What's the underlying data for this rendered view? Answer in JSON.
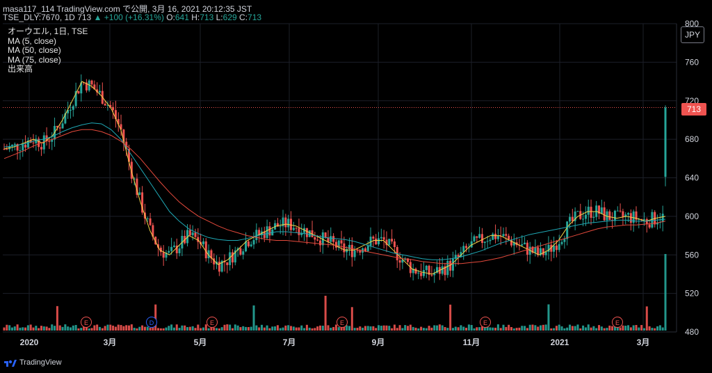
{
  "header": {
    "publish_line": "masa117_114 TradingView.com で公開, 3月 16, 2021 20:12:35 JST",
    "symbol": "TSE_DLY:7670, 1D",
    "last": "713",
    "change": "+100 (+16.31%)",
    "open_label": "O:",
    "open": "641",
    "high_label": "H:",
    "high": "713",
    "low_label": "L:",
    "low": "629",
    "close_label": "C:",
    "close": "713"
  },
  "legend": {
    "title": "オーウエル, 1日, TSE",
    "ma5": "MA (5, close)",
    "ma50": "MA (50, close)",
    "ma75": "MA (75, close)",
    "volume": "出来高"
  },
  "currency": "JPY",
  "price_badge": "713",
  "brand": "TradingView",
  "colors": {
    "up": "#26a69a",
    "down": "#ef5350",
    "ma5": "#f5d547",
    "ma50": "#1fa8b5",
    "ma75": "#e64a3c",
    "price_line": "#ef5350"
  },
  "events": [
    "E",
    "E",
    "D",
    "E",
    "E",
    "E",
    "E"
  ],
  "chart_data": {
    "type": "candlestick",
    "y_ticks": [
      480,
      520,
      560,
      600,
      640,
      680,
      720,
      760,
      800
    ],
    "ylim": [
      480,
      800
    ],
    "x_labels": [
      "2020",
      "3月",
      "5月",
      "7月",
      "9月",
      "11月",
      "2021",
      "3月"
    ],
    "grid": true,
    "series": [
      {
        "name": "MA (5, close)",
        "values": [
          670,
          672,
          676,
          680,
          676,
          684,
          700,
          720,
          740,
          735,
          725,
          712,
          690,
          650,
          615,
          585,
          565,
          560,
          570,
          580,
          575,
          560,
          550,
          555,
          565,
          575,
          580,
          585,
          590,
          592,
          590,
          585,
          580,
          575,
          570,
          565,
          565,
          570,
          575,
          575,
          565,
          555,
          545,
          542,
          540,
          545,
          550,
          560,
          570,
          575,
          580,
          580,
          575,
          570,
          565,
          560,
          565,
          575,
          590,
          600,
          605,
          605,
          600,
          598,
          600,
          598,
          595,
          598,
          600
        ]
      },
      {
        "name": "MA (50, close)",
        "values": [
          672,
          673,
          675,
          678,
          680,
          683,
          688,
          692,
          695,
          697,
          696,
          690,
          680,
          665,
          650,
          635,
          620,
          605,
          595,
          587,
          582,
          578,
          576,
          575,
          575,
          577,
          580,
          582,
          584,
          584,
          583,
          582,
          580,
          578,
          577,
          576,
          574,
          571,
          568,
          565,
          562,
          560,
          558,
          556,
          555,
          555,
          556,
          558,
          561,
          564,
          568,
          572,
          575,
          578,
          581,
          583,
          585,
          587,
          589,
          591,
          593,
          594,
          595,
          596,
          596,
          595,
          595,
          596,
          597
        ]
      },
      {
        "name": "MA (75, close)",
        "values": [
          660,
          664,
          668,
          673,
          677,
          680,
          684,
          688,
          690,
          690,
          688,
          684,
          678,
          670,
          660,
          648,
          636,
          625,
          615,
          607,
          600,
          595,
          590,
          586,
          583,
          580,
          578,
          576,
          575,
          575,
          574,
          573,
          572,
          571,
          570,
          568,
          566,
          564,
          562,
          560,
          558,
          556,
          555,
          553,
          552,
          551,
          551,
          551,
          552,
          553,
          555,
          557,
          560,
          563,
          566,
          569,
          572,
          575,
          578,
          581,
          584,
          587,
          589,
          590,
          591,
          591,
          592,
          593,
          595
        ]
      }
    ],
    "annotations": [
      "E",
      "D",
      "E",
      "E",
      "E",
      "E",
      "E"
    ],
    "last_price": 713
  }
}
